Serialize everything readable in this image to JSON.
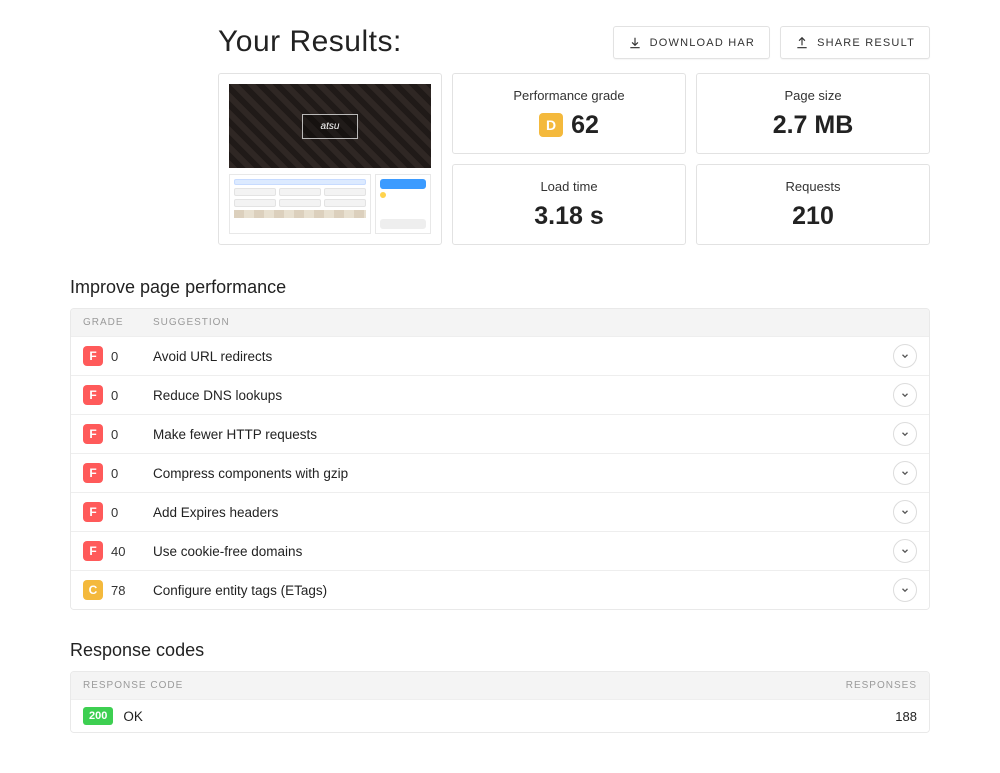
{
  "header": {
    "title": "Your Results:",
    "download_label": "DOWNLOAD HAR",
    "share_label": "SHARE RESULT"
  },
  "thumbnail": {
    "logo_text": "atsu"
  },
  "metrics": {
    "perf_label": "Performance grade",
    "perf_grade": "D",
    "perf_value": "62",
    "size_label": "Page size",
    "size_value": "2.7 MB",
    "load_label": "Load time",
    "load_value": "3.18 s",
    "req_label": "Requests",
    "req_value": "210"
  },
  "improve": {
    "title": "Improve page performance",
    "head_grade": "GRADE",
    "head_sugg": "SUGGESTION",
    "rows": [
      {
        "grade": "F",
        "score": "0",
        "text": "Avoid URL redirects"
      },
      {
        "grade": "F",
        "score": "0",
        "text": "Reduce DNS lookups"
      },
      {
        "grade": "F",
        "score": "0",
        "text": "Make fewer HTTP requests"
      },
      {
        "grade": "F",
        "score": "0",
        "text": "Compress components with gzip"
      },
      {
        "grade": "F",
        "score": "0",
        "text": "Add Expires headers"
      },
      {
        "grade": "F",
        "score": "40",
        "text": "Use cookie-free domains"
      },
      {
        "grade": "C",
        "score": "78",
        "text": "Configure entity tags (ETags)"
      }
    ]
  },
  "response_codes": {
    "title": "Response codes",
    "head_code": "RESPONSE CODE",
    "head_responses": "RESPONSES",
    "rows": [
      {
        "code": "200",
        "label": "OK",
        "count": "188"
      }
    ]
  }
}
